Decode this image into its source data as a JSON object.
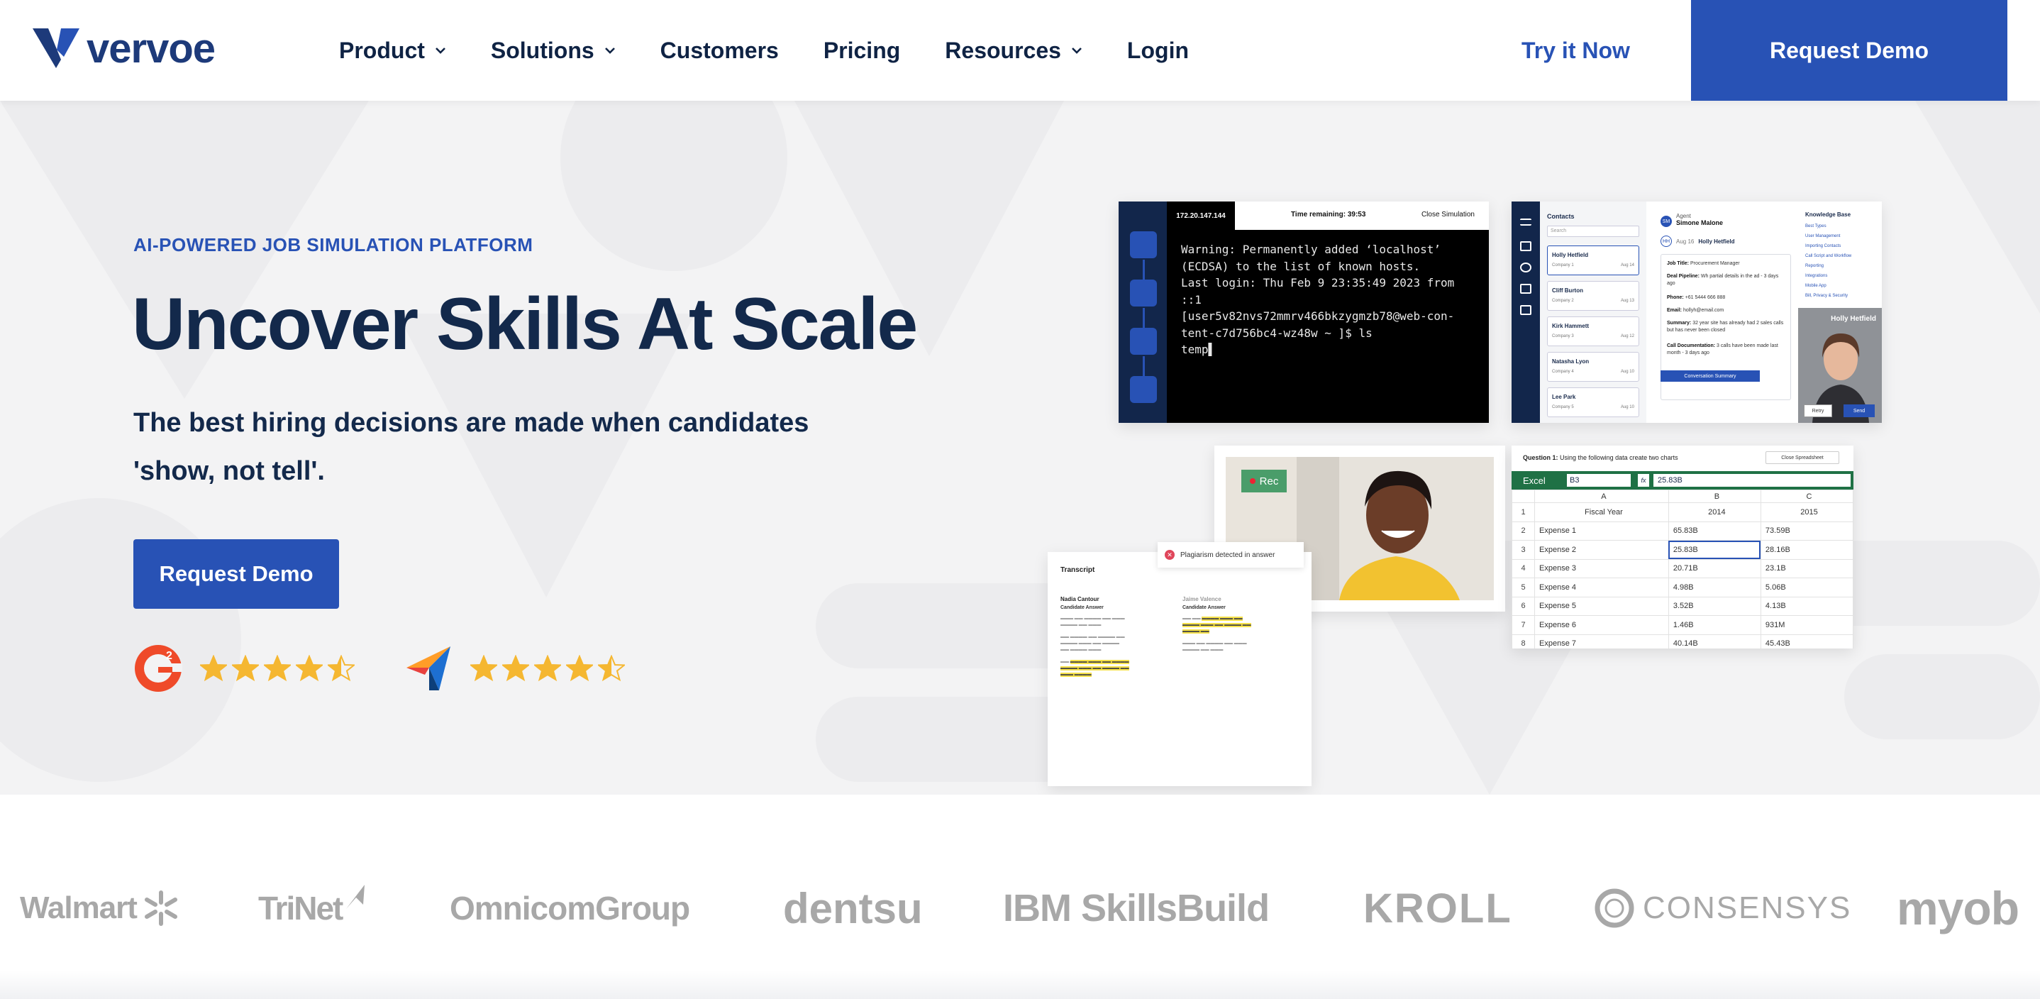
{
  "nav": {
    "logo_text": "vervoe",
    "items": [
      {
        "label": "Product",
        "dropdown": true
      },
      {
        "label": "Solutions",
        "dropdown": true
      },
      {
        "label": "Customers",
        "dropdown": false
      },
      {
        "label": "Pricing",
        "dropdown": false
      },
      {
        "label": "Resources",
        "dropdown": true
      },
      {
        "label": "Login",
        "dropdown": false
      }
    ],
    "try_label": "Try it Now",
    "cta_label": "Request Demo"
  },
  "hero": {
    "eyebrow": "AI-POWERED JOB SIMULATION PLATFORM",
    "headline": "Uncover Skills At Scale",
    "subline": "The best hiring decisions are made when candidates 'show, not tell'.",
    "cta_label": "Request Demo",
    "ratings": [
      {
        "source": "G2",
        "icon": "g2-logo-icon",
        "stars": 4.5,
        "max": 5
      },
      {
        "source": "Capterra",
        "icon": "capterra-logo-icon",
        "stars": 4.5,
        "max": 5
      }
    ]
  },
  "collage": {
    "terminal": {
      "ip": "172.20.147.144",
      "time_remaining": "Time remaining: 39:53",
      "close": "Close Simulation",
      "lines": "Warning: Permanently added ‘localhost’\n(ECDSA) to the list of known hosts.\nLast login: Thu Feb 9 23:35:49 2023 from\n::1\n[user5v82nvs72mmrv466bkzygmzb78@web-con-\ntent-c7d756bc4-wz48w ~ ]$ ls\ntemp▌"
    },
    "crm": {
      "contacts_title": "Contacts",
      "search": "Search",
      "contacts": [
        {
          "name": "Holly Hetfield",
          "sub": "Company 1",
          "date": "Aug 14"
        },
        {
          "name": "Cliff Burton",
          "sub": "Company 2",
          "date": "Aug 13"
        },
        {
          "name": "Kirk Hammett",
          "sub": "Company 3",
          "date": "Aug 12"
        },
        {
          "name": "Natasha Lyon",
          "sub": "Company 4",
          "date": "Aug 10"
        },
        {
          "name": "Lee Park",
          "sub": "Company 5",
          "date": "Aug 10"
        }
      ],
      "agent_label": "Agent",
      "agent_name": "Simone Malone",
      "agent_initials": "SM",
      "contact_line_date": "Aug 16",
      "contact_line_name": "Holly Hetfield",
      "contact_initials": "HH",
      "fields": [
        {
          "k": "Job Title:",
          "v": "Procurement Manager"
        },
        {
          "k": "Deal Pipeline:",
          "v": "Wh partial details in the ad - 3 days ago"
        },
        {
          "k": "Phone:",
          "v": "+61 5444 666 888"
        },
        {
          "k": "Email:",
          "v": "hollyh@email.com"
        },
        {
          "k": "Summary:",
          "v": "32 year site has already had 2 sales calls but has never been closed"
        },
        {
          "k": "Call Documentation:",
          "v": "3 calls have been made last month - 3 days ago"
        }
      ],
      "summary_button": "Conversation Summary",
      "kb_title": "Knowledge Base",
      "kb_links": [
        "Best Types",
        "User Management",
        "Importing Contacts",
        "Call Script and Workflow",
        "Reporting",
        "Integrations",
        "Mobile App",
        "Bill, Privacy & Security"
      ],
      "video_name": "Holly Hetfield",
      "retry": "Retry",
      "send": "Send"
    },
    "video": {
      "rec_label": "Rec"
    },
    "transcript": {
      "title": "Transcript",
      "plagiarism": "Plagiarism detected in answer",
      "cols": [
        {
          "name": "Nadia Cantour",
          "sub": "Candidate Answer"
        },
        {
          "name": "Jaime Valence",
          "sub": "Candidate Answer"
        }
      ]
    },
    "excel": {
      "question_label": "Question 1:",
      "question": "Using the following data create two charts",
      "close": "Close Spreadsheet",
      "app_label": "Excel",
      "cell_ref": "B3",
      "fx": "fx",
      "formula_value": "25.83B",
      "columns": [
        "A",
        "B",
        "C"
      ],
      "rows": [
        [
          "1",
          "Fiscal Year",
          "2014",
          "2015"
        ],
        [
          "2",
          "Expense 1",
          "65.83B",
          "73.59B"
        ],
        [
          "3",
          "Expense 2",
          "25.83B",
          "28.16B"
        ],
        [
          "4",
          "Expense 3",
          "20.71B",
          "23.1B"
        ],
        [
          "5",
          "Expense 4",
          "4.98B",
          "5.06B"
        ],
        [
          "6",
          "Expense 5",
          "3.52B",
          "4.13B"
        ],
        [
          "7",
          "Expense 6",
          "1.46B",
          "931M"
        ],
        [
          "8",
          "Expense 7",
          "40.14B",
          "45.43B"
        ]
      ]
    }
  },
  "customers": [
    {
      "name": "Walmart",
      "icon": "walmart-spark-icon"
    },
    {
      "name": "TriNet",
      "icon": "trinet-arrow-icon"
    },
    {
      "name": "OmnicomGroup",
      "icon": ""
    },
    {
      "name": "dentsu",
      "icon": ""
    },
    {
      "name": "IBM SkillsBuild",
      "icon": ""
    },
    {
      "name": "KROLL",
      "icon": ""
    },
    {
      "name": "CONSENSYS",
      "icon": "consensys-ring-icon"
    },
    {
      "name": "myob",
      "icon": ""
    }
  ]
}
